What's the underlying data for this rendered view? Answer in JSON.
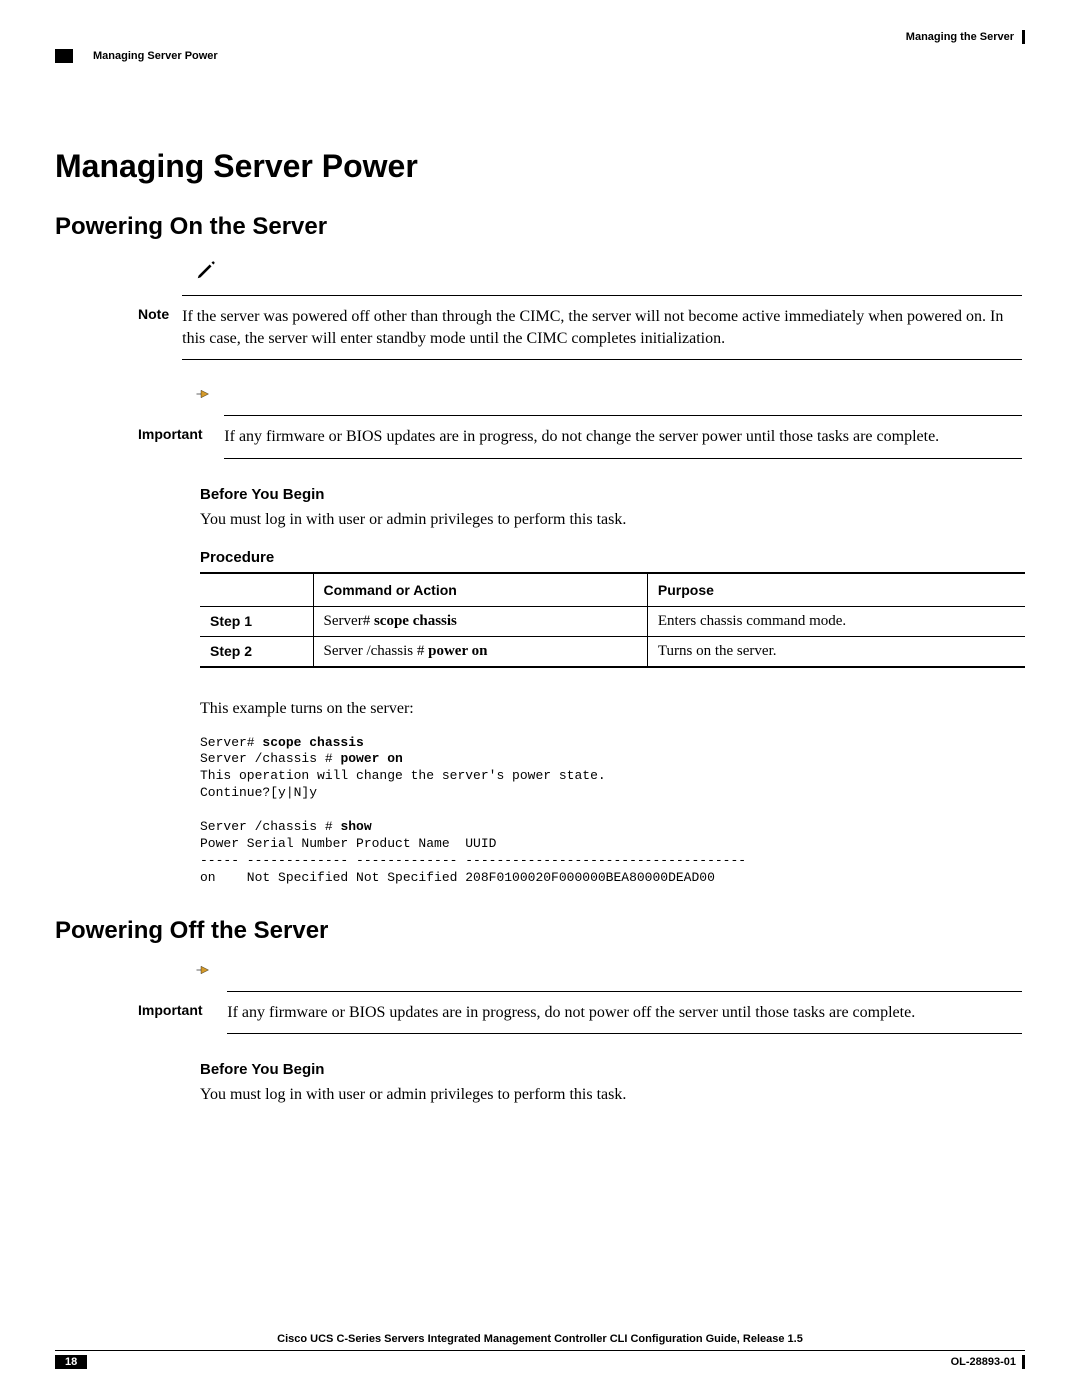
{
  "header": {
    "right_title": "Managing the Server",
    "left_section": "Managing Server Power"
  },
  "h1": "Managing Server Power",
  "powering_on": {
    "h2": "Powering On the Server",
    "note_label": "Note",
    "note_text": "If the server was powered off other than through the CIMC, the server will not become active immediately when powered on. In this case, the server will enter standby mode until the CIMC completes initialization.",
    "important_label": "Important",
    "important_text": "If any firmware or BIOS updates are in progress, do not change the server power until those tasks are complete.",
    "before_h3": "Before You Begin",
    "before_text": "You must log in with user or admin privileges to perform this task.",
    "procedure_h3": "Procedure",
    "table": {
      "headers": [
        "",
        "Command or Action",
        "Purpose"
      ],
      "rows": [
        {
          "step": "Step 1",
          "cmd_prefix": "Server# ",
          "cmd_bold": "scope chassis",
          "purpose": "Enters chassis command mode."
        },
        {
          "step": "Step 2",
          "cmd_prefix": "Server /chassis # ",
          "cmd_bold": "power on",
          "purpose": "Turns on the server."
        }
      ]
    },
    "example_intro": "This example turns on the server:",
    "code": "Server# scope chassis\nServer /chassis # power on\nThis operation will change the server's power state.\nContinue?[y|N]y\n\nServer /chassis # show\nPower Serial Number Product Name  UUID\n----- ------------- ------------- ------------------------------------\non    Not Specified Not Specified 208F0100020F000000BEA80000DEAD00",
    "code_bold_segments": [
      "scope chassis",
      "power on",
      "show"
    ]
  },
  "powering_off": {
    "h2": "Powering Off the Server",
    "important_label": "Important",
    "important_text": "If any firmware or BIOS updates are in progress, do not power off the server until those tasks are complete.",
    "before_h3": "Before You Begin",
    "before_text": "You must log in with user or admin privileges to perform this task."
  },
  "footer": {
    "title": "Cisco UCS C-Series Servers Integrated Management Controller CLI Configuration Guide, Release 1.5",
    "page_num": "18",
    "doc_id": "OL-28893-01"
  }
}
